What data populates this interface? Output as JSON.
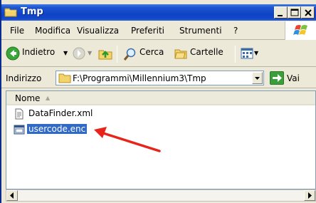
{
  "window": {
    "title": "Tmp",
    "controls": {
      "minimize": "_",
      "maximize": "□",
      "close": "×"
    }
  },
  "menu": [
    "File",
    "Modifica",
    "Visualizza",
    "Preferiti",
    "Strumenti",
    "?"
  ],
  "toolbar": {
    "back_label": "Indietro",
    "search_label": "Cerca",
    "folders_label": "Cartelle"
  },
  "address": {
    "label": "Indirizzo",
    "value": "F:\\Programmi\\Millennium3\\Tmp",
    "go_label": "Vai"
  },
  "list": {
    "column_header": "Nome",
    "sort_indicator": "▲",
    "files": [
      {
        "name": "DataFinder.xml",
        "icon": "xml-file-icon",
        "selected": false
      },
      {
        "name": "usercode.enc",
        "icon": "enc-file-icon",
        "selected": true
      }
    ]
  },
  "annotation": {
    "arrow_color": "#e8231a"
  },
  "colors": {
    "titlebar": "#0f43c6",
    "selection": "#316ac5",
    "chrome": "#ece9d8"
  }
}
